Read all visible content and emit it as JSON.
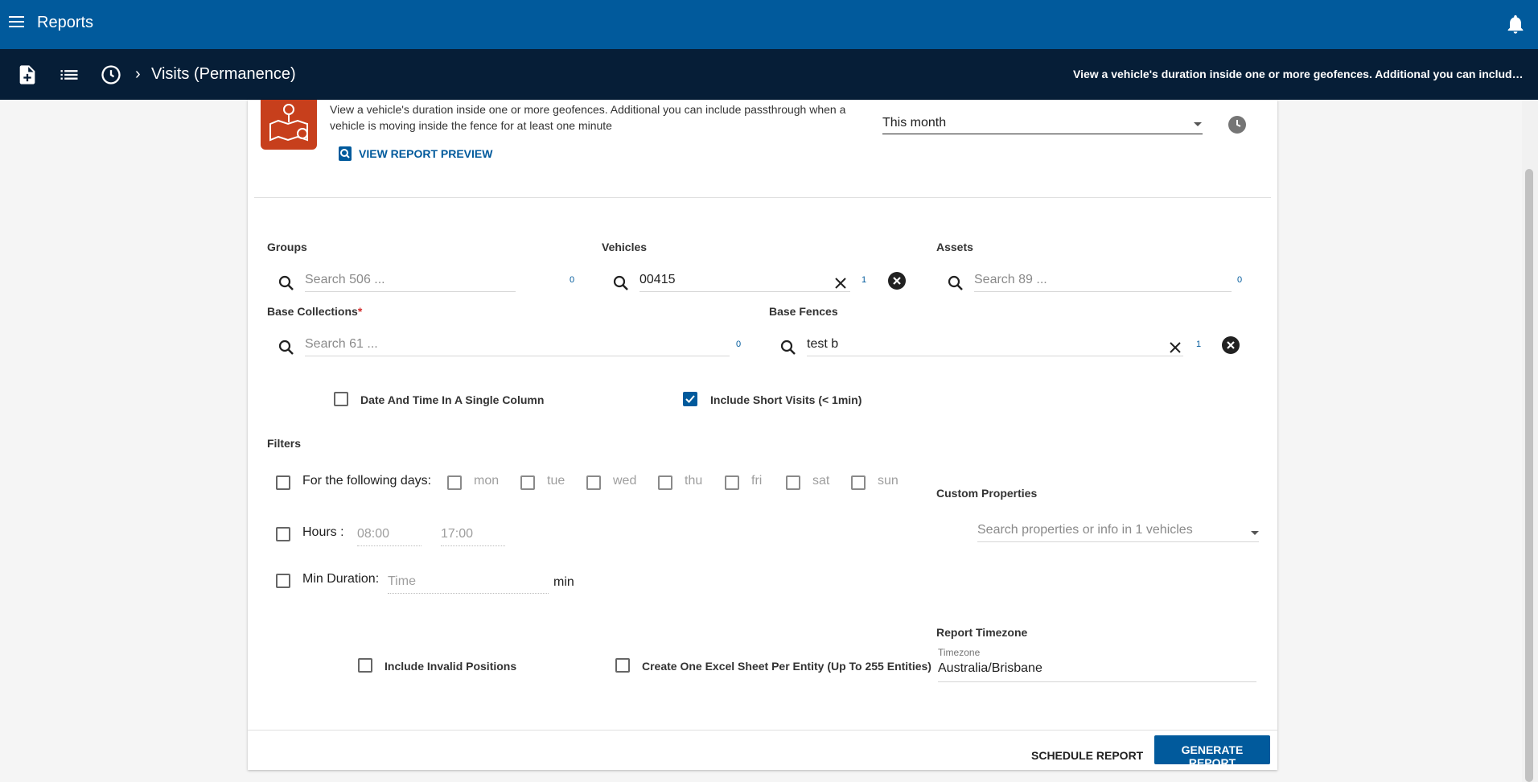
{
  "app": {
    "title": "Reports"
  },
  "breadcrumb": {
    "current": "Visits (Permanence)",
    "description": "View a vehicle's duration inside one or more geofences. Additional you can include passthrough when a vehicle is moving inside the fence for at least one minute"
  },
  "report": {
    "description": "View a vehicle's duration inside one or more geofences. Additional you can include passthrough when a vehicle is moving inside the fence for at least one minute",
    "preview_label": "VIEW REPORT PREVIEW",
    "period_value": "This month"
  },
  "groups": {
    "label": "Groups",
    "placeholder": "Search 506 ...",
    "count": "0"
  },
  "vehicles": {
    "label": "Vehicles",
    "value": "00415",
    "count": "1"
  },
  "assets": {
    "label": "Assets",
    "placeholder": "Search 89 ...",
    "count": "0"
  },
  "base_collections": {
    "label": "Base Collections",
    "required_mark": "*",
    "placeholder": "Search 61 ...",
    "count": "0"
  },
  "base_fences": {
    "label": "Base Fences",
    "value": "test b",
    "count": "1"
  },
  "options": {
    "date_time_single_column": {
      "label": "Date And Time In A Single Column",
      "checked": false
    },
    "include_short_visits": {
      "label": "Include Short Visits (< 1min)",
      "checked": true
    }
  },
  "filters": {
    "label": "Filters",
    "days_label": "For the following days:",
    "days": [
      "mon",
      "tue",
      "wed",
      "thu",
      "fri",
      "sat",
      "sun"
    ],
    "hours_label": "Hours :",
    "hours_from_placeholder": "08:00",
    "hours_to_placeholder": "17:00",
    "min_duration_label": "Min Duration:",
    "min_duration_placeholder": "Time",
    "min_duration_unit": "min"
  },
  "custom_properties": {
    "label": "Custom Properties",
    "placeholder": "Search properties or info in 1 vehicles"
  },
  "bottom_options": {
    "include_invalid_positions": {
      "label": "Include Invalid Positions",
      "checked": false
    },
    "one_sheet_per_entity": {
      "label": "Create One Excel Sheet Per Entity (Up To 255 Entities)",
      "checked": false
    }
  },
  "timezone": {
    "label": "Report Timezone",
    "field_label": "Timezone",
    "value": "Australia/Brisbane"
  },
  "actions": {
    "schedule_label": "SCHEDULE REPORT",
    "generate_label": "GENERATE REPORT"
  },
  "colors": {
    "primary": "#015a9c",
    "header_dark": "#061e37",
    "report_icon": "#c73f1c"
  }
}
